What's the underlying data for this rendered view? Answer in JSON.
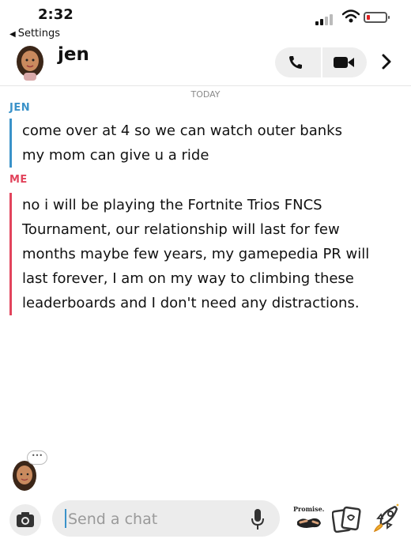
{
  "status_bar": {
    "time": "2:32",
    "back_label": "Settings",
    "battery_color": "#e02020"
  },
  "header": {
    "name": "jen",
    "icons": [
      "phone-icon",
      "video-icon",
      "chevron-right-icon"
    ]
  },
  "chat": {
    "date": "TODAY",
    "messages": [
      {
        "sender": "JEN",
        "color": "#3a92c9",
        "lines": [
          "come over at 4 so we can watch outer banks",
          "my mom can give u a ride"
        ]
      },
      {
        "sender": "ME",
        "color": "#e2445c",
        "lines": [
          "no i will be playing the Fortnite Trios FNCS",
          "Tournament, our relationship will last for few",
          "months maybe few years, my gamepedia PR will",
          "last forever, I am on my way to climbing these",
          "leaderboards and I don't need any distractions."
        ]
      }
    ]
  },
  "composer": {
    "placeholder": "Send a chat",
    "typing_indicator": "•••",
    "sticker_label": "Promise.",
    "icons": [
      "camera-icon",
      "mic-icon",
      "bitmoji-sticker",
      "card-icon",
      "rocket-icon"
    ]
  }
}
